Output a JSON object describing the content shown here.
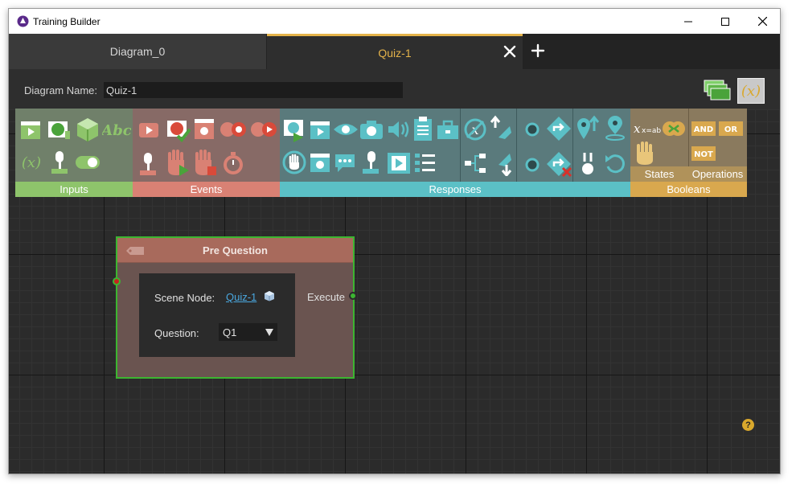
{
  "window": {
    "title": "Training Builder"
  },
  "tabs": [
    {
      "label": "Diagram_0",
      "active": false
    },
    {
      "label": "Quiz-1",
      "active": true
    }
  ],
  "diagram": {
    "name_label": "Diagram Name:",
    "name_value": "Quiz-1"
  },
  "toolbox": {
    "groups": [
      {
        "label": "Inputs",
        "color": "#8ec46b"
      },
      {
        "label": "Events",
        "color": "#d98174"
      },
      {
        "label": "Responses",
        "color": "#5bc0c6"
      },
      {
        "label": "Booleans",
        "color": "#d9a84e"
      }
    ],
    "states_label": "States",
    "operations_label": "Operations",
    "bool_ops": {
      "and": "AND",
      "or": "OR",
      "not": "NOT"
    },
    "var_label": "x=abc"
  },
  "node": {
    "title": "Pre Question",
    "scene_label": "Scene Node:",
    "scene_value": "Quiz-1",
    "question_label": "Question:",
    "question_value": "Q1",
    "execute_label": "Execute"
  },
  "colors": {
    "accent": "#e4b34a",
    "connected": "#3cb531",
    "input_port": "#c62020"
  }
}
